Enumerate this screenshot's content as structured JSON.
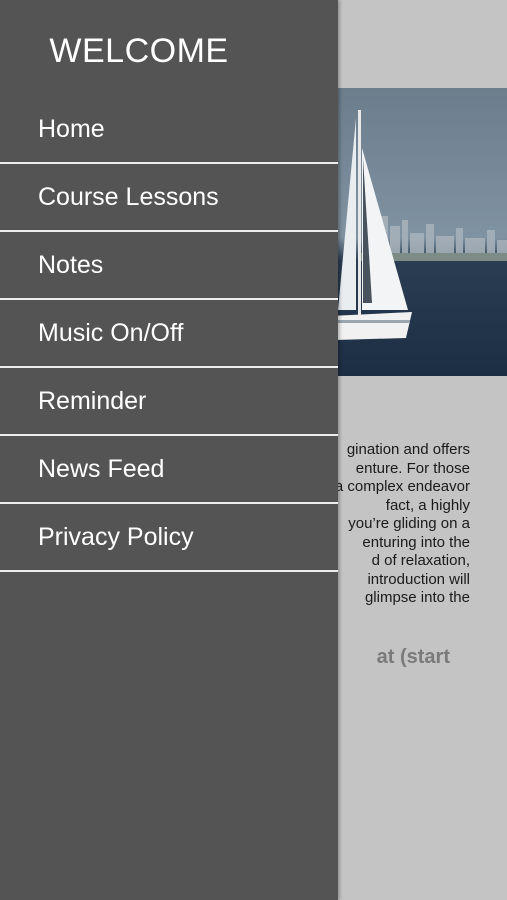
{
  "drawer": {
    "title": "WELCOME",
    "items": [
      {
        "label": "Home"
      },
      {
        "label": "Course Lessons"
      },
      {
        "label": "Notes"
      },
      {
        "label": "Music On/Off"
      },
      {
        "label": "Reminder"
      },
      {
        "label": "News Feed"
      },
      {
        "label": "Privacy Policy"
      }
    ]
  },
  "content": {
    "image": "sailboat-photo",
    "body_lines": [
      "gination and offers",
      "enture. For those",
      "a complex endeavor",
      "fact, a highly",
      "you’re gliding on a",
      "enturing into the",
      "d of relaxation,",
      "introduction will",
      "glimpse into the"
    ],
    "subheading": "at (start"
  },
  "colors": {
    "drawer_bg": "#545454",
    "content_bg": "#c4c4c4",
    "divider": "#ededed"
  }
}
